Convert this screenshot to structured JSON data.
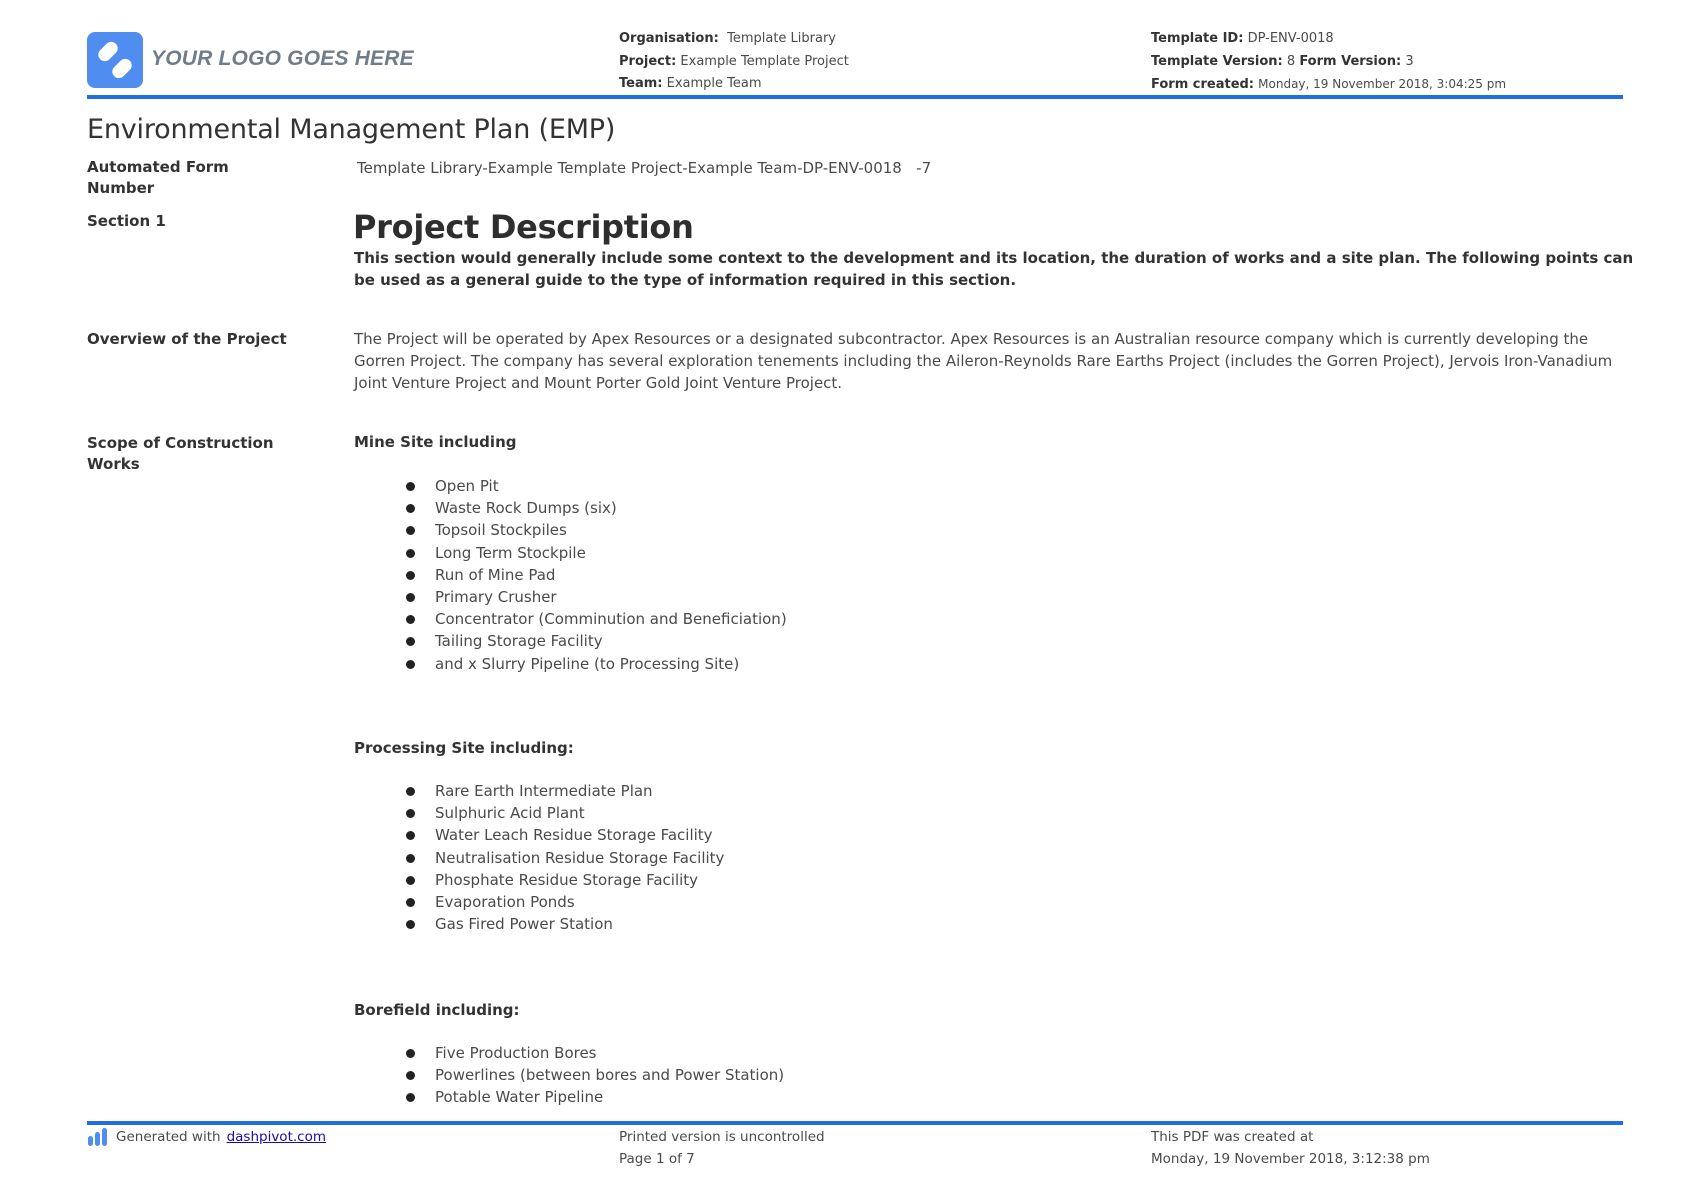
{
  "header": {
    "logo_text": "YOUR LOGO GOES HERE",
    "organisation_label": "Organisation:",
    "organisation_value": "Template Library",
    "project_label": "Project:",
    "project_value": "Example Template Project",
    "team_label": "Team:",
    "team_value": "Example Team",
    "template_id_label": "Template ID:",
    "template_id_value": "DP-ENV-0018",
    "template_version_label": "Template Version:",
    "template_version_value": "8",
    "form_version_label": "Form Version:",
    "form_version_value": "3",
    "form_created_label": "Form created:",
    "form_created_value": "Monday, 19 November 2018, 3:04:25 pm",
    "accent_color": "#1f6fe0"
  },
  "document": {
    "title": "Environmental Management Plan (EMP)",
    "automated_form_number_label": "Automated Form Number",
    "automated_form_number_value": "Template Library-Example Template Project-Example Team-DP-ENV-0018   -7",
    "section_label": "Section 1",
    "section_heading": "Project Description",
    "section_intro": "This section would generally include some context to the development and its location, the duration of works and a site plan. The following points can be used as a general guide to the type of information required in this section.",
    "overview_label": "Overview of the Project",
    "overview_text": "The Project will be operated by Apex Resources or a designated subcontractor. Apex Resources is an Australian resource company which is currently developing the Gorren Project. The company has several exploration tenements including the Aileron-Reynolds Rare Earths Project (includes the Gorren Project), Jervois Iron-Vanadium Joint Venture Project and Mount Porter Gold Joint Venture Project.",
    "scope_label": "Scope of Construction Works",
    "scope_groups": [
      {
        "heading": "Mine Site including",
        "items": [
          "Open Pit",
          "Waste Rock Dumps (six)",
          "Topsoil Stockpiles",
          "Long Term Stockpile",
          "Run of Mine Pad",
          "Primary Crusher",
          "Concentrator (Comminution and Beneficiation)",
          "Tailing Storage Facility",
          "and x Slurry Pipeline (to Processing Site)"
        ]
      },
      {
        "heading": "Processing Site including:",
        "items": [
          "Rare Earth Intermediate Plan",
          "Sulphuric Acid Plant",
          "Water Leach Residue Storage Facility",
          "Neutralisation Residue Storage Facility",
          "Phosphate Residue Storage Facility",
          "Evaporation Ponds",
          "Gas Fired Power Station"
        ]
      },
      {
        "heading": "Borefield including:",
        "items": [
          "Five Production Bores",
          "Powerlines (between bores and Power Station)",
          "Potable Water Pipeline"
        ]
      }
    ]
  },
  "footer": {
    "generated_with": "Generated with",
    "link_text": "dashpivot.com",
    "uncontrolled_text": "Printed version is uncontrolled",
    "page_text": "Page 1 of 7",
    "pdf_created_label": "This PDF was created at",
    "pdf_created_value": "Monday, 19 November 2018, 3:12:38 pm"
  }
}
